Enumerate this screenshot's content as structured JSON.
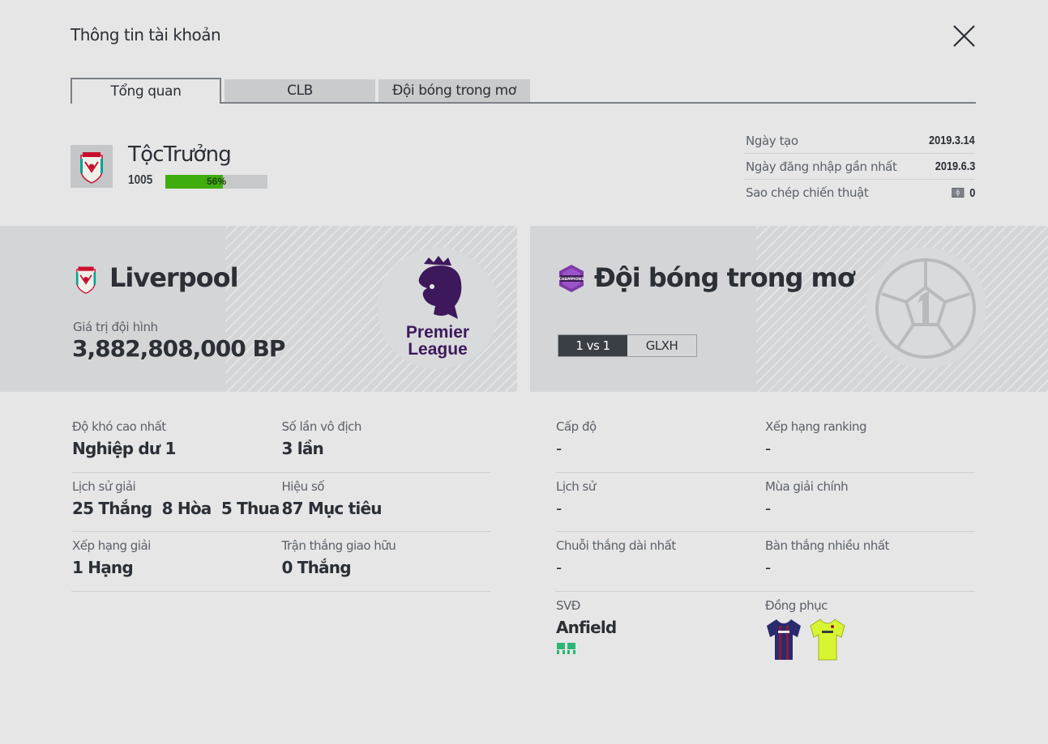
{
  "window": {
    "title": "Thông tin tài khoản"
  },
  "tabs": [
    {
      "label": "Tổng quan",
      "active": true
    },
    {
      "label": "CLB",
      "active": false
    },
    {
      "label": "Đội bóng trong mơ",
      "active": false
    }
  ],
  "profile": {
    "username": "TộcTrưởng",
    "level": "1005",
    "xp_percent": 56,
    "xp_text": "56%"
  },
  "meta": {
    "created_label": "Ngày tạo",
    "created_value": "2019.3.14",
    "last_login_label": "Ngày đăng nhập gần nhất",
    "last_login_value": "2019.6.3",
    "tactics_copy_label": "Sao chép chiến thuật",
    "tactics_copy_value": "0"
  },
  "club": {
    "name": "Liverpool",
    "squad_value_label": "Giá trị đội hình",
    "squad_value": "3,882,808,000 BP",
    "league_logo_text_1": "Premier",
    "league_logo_text_2": "League"
  },
  "dream_team": {
    "name": "Đội bóng trong mơ",
    "badge_text": "CHAMPIONS",
    "modes": [
      {
        "label": "1 vs 1",
        "active": true
      },
      {
        "label": "GLXH",
        "active": false
      }
    ]
  },
  "club_stats": [
    {
      "label": "Độ khó cao nhất",
      "value": "Nghiệp dư 1"
    },
    {
      "label": "Số lần vô địch",
      "value": "3 lần"
    },
    {
      "label": "Lịch sử giải",
      "value": "25 Thắng  8 Hòa  5 Thua"
    },
    {
      "label": "Hiệu số",
      "value": "87 Mục tiêu"
    },
    {
      "label": "Xếp hạng giải",
      "value": "1 Hạng"
    },
    {
      "label": "Trận thắng giao hữu",
      "value": "0 Thắng"
    }
  ],
  "dream_stats": [
    {
      "label": "Cấp độ",
      "value": "-"
    },
    {
      "label": "Xếp hạng ranking",
      "value": "-"
    },
    {
      "label": "Lịch sử",
      "value": "-"
    },
    {
      "label": "Mùa giải chính",
      "value": "-"
    },
    {
      "label": "Chuỗi thắng dài nhất",
      "value": "-"
    },
    {
      "label": "Bàn thắng nhiều nhất",
      "value": "-"
    },
    {
      "label": "SVĐ",
      "value": "Anfield"
    },
    {
      "label": "Đồng phục",
      "value": ""
    }
  ],
  "icons": {
    "close": "close-icon",
    "club_crest": "liverpool-crest-icon",
    "league": "premier-league-logo",
    "dream_badge": "champions-badge-icon",
    "ball": "ball-number-1-icon",
    "stadium": "stadium-seats-icon",
    "tactics": "tactics-board-icon",
    "kit_home": "home-kit-icon",
    "kit_away": "away-kit-icon"
  },
  "colors": {
    "background": "#e6e6e6",
    "panel": "#d3d5d7",
    "xp_fill": "#3fad0d",
    "league_purple": "#3d195b",
    "stadium_icon": "#2bb673",
    "active_mode": "#3a3e45"
  }
}
